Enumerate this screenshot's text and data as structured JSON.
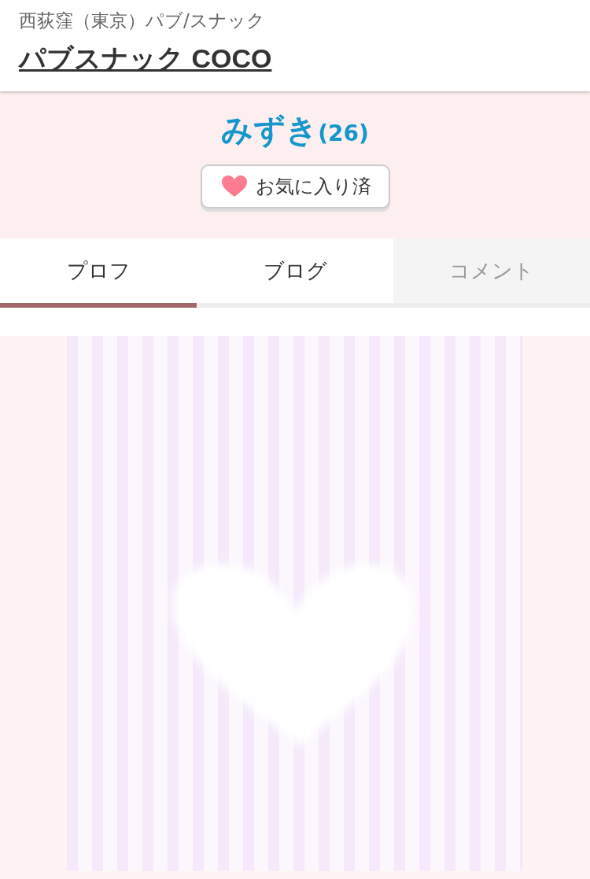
{
  "header": {
    "area": "西荻窪（東京）パブ/スナック",
    "shop_name": "パブスナック COCO"
  },
  "profile": {
    "name": "みずき",
    "age": "(26)",
    "favorite_button": {
      "label": "お気に入り済",
      "favorited": true
    }
  },
  "tabs": [
    {
      "label": "プロフ",
      "selected": true,
      "disabled": false
    },
    {
      "label": "ブログ",
      "selected": false,
      "disabled": false
    },
    {
      "label": "コメント",
      "selected": false,
      "disabled": true
    }
  ]
}
